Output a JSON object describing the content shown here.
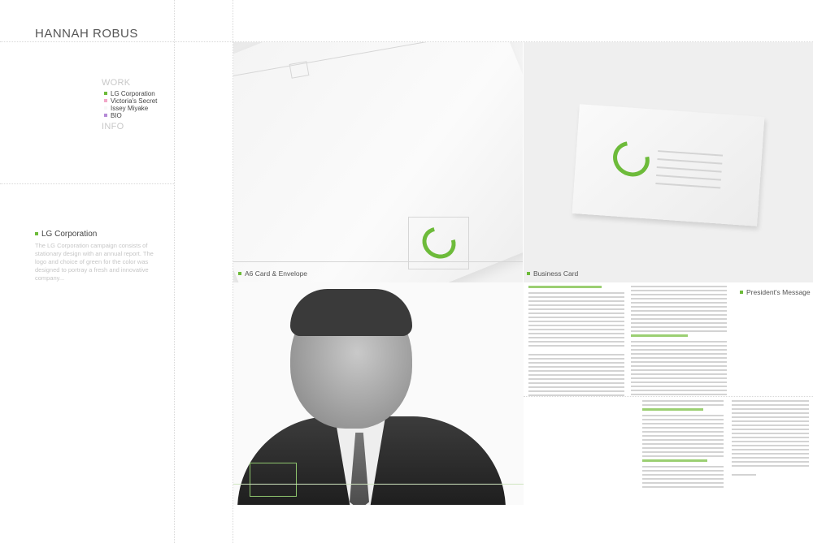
{
  "site": {
    "title": "HANNAH ROBUS"
  },
  "nav": {
    "work_label": "WORK",
    "info_label": "INFO",
    "items": [
      {
        "label": "LG Corporation",
        "color": "#6dbb3a"
      },
      {
        "label": "Victoria's Secret",
        "color": "#f2a7c8"
      },
      {
        "label": "Issey Miyake",
        "color": "#f7f7f7"
      },
      {
        "label": "BIO",
        "color": "#b58ad6"
      }
    ]
  },
  "project": {
    "title": "LG Corporation",
    "accent": "#6dbb3a",
    "description": "The LG Corporation campaign consists of stationary design with an annual report. The logo and choice of green for the color was designed to portray a fresh and innovative company..."
  },
  "gallery": {
    "captions": [
      "A6 Card & Envelope",
      "Business Card",
      "President's Message"
    ]
  }
}
